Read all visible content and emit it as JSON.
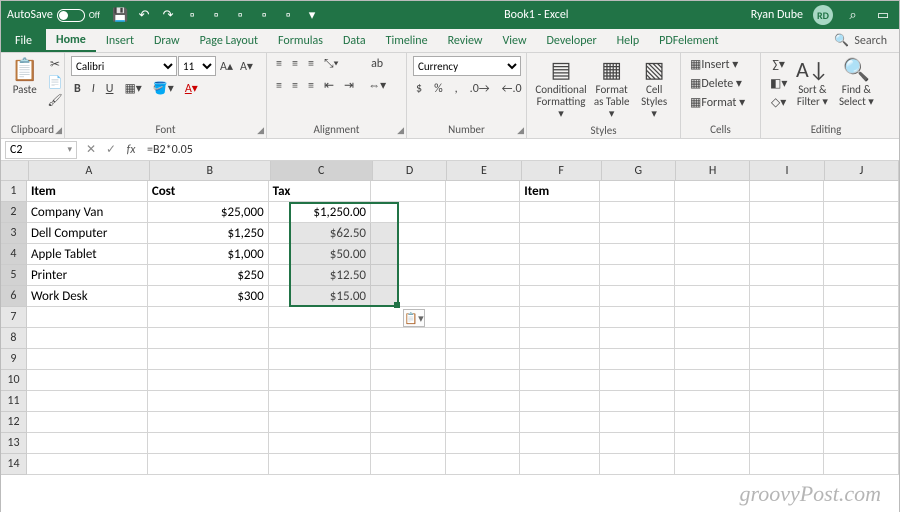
{
  "titlebar": {
    "autosave_label": "AutoSave",
    "autosave_state": "Off",
    "title": "Book1 - Excel",
    "user_name": "Ryan Dube",
    "user_initials": "RD"
  },
  "tabs": {
    "file": "File",
    "home": "Home",
    "insert": "Insert",
    "draw": "Draw",
    "page_layout": "Page Layout",
    "formulas": "Formulas",
    "data": "Data",
    "timeline": "Timeline",
    "review": "Review",
    "view": "View",
    "developer": "Developer",
    "help": "Help",
    "pdf": "PDFelement",
    "search": "Search"
  },
  "ribbon": {
    "clipboard": {
      "label": "Clipboard",
      "paste": "Paste"
    },
    "font": {
      "label": "Font",
      "name": "Calibri",
      "size": "11",
      "bold": "B",
      "italic": "I",
      "underline": "U"
    },
    "alignment": {
      "label": "Alignment",
      "wrap": "ab"
    },
    "number": {
      "label": "Number",
      "format": "Currency",
      "dollar": "$",
      "percent": "%",
      "comma": ","
    },
    "styles": {
      "label": "Styles",
      "conditional": "Conditional Formatting ▾",
      "table": "Format as Table ▾",
      "cell": "Cell Styles ▾"
    },
    "cells": {
      "label": "Cells",
      "insert": "Insert ▾",
      "delete": "Delete ▾",
      "format": "Format ▾"
    },
    "editing": {
      "label": "Editing",
      "sort": "Sort & Filter ▾",
      "find": "Find & Select ▾"
    }
  },
  "formula_bar": {
    "name_box": "C2",
    "formula": "=B2*0.05"
  },
  "columns": [
    "A",
    "B",
    "C",
    "D",
    "E",
    "F",
    "G",
    "H",
    "I",
    "J"
  ],
  "headers": {
    "item": "Item",
    "cost": "Cost",
    "tax": "Tax",
    "item2": "Item"
  },
  "rows": [
    {
      "item": "Company Van",
      "cost": "$25,000",
      "tax": "$1,250.00"
    },
    {
      "item": "Dell Computer",
      "cost": "$1,250",
      "tax": "$62.50"
    },
    {
      "item": "Apple Tablet",
      "cost": "$1,000",
      "tax": "$50.00"
    },
    {
      "item": "Printer",
      "cost": "$250",
      "tax": "$12.50"
    },
    {
      "item": "Work Desk",
      "cost": "$300",
      "tax": "$15.00"
    }
  ],
  "watermark": "groovyPost.com"
}
